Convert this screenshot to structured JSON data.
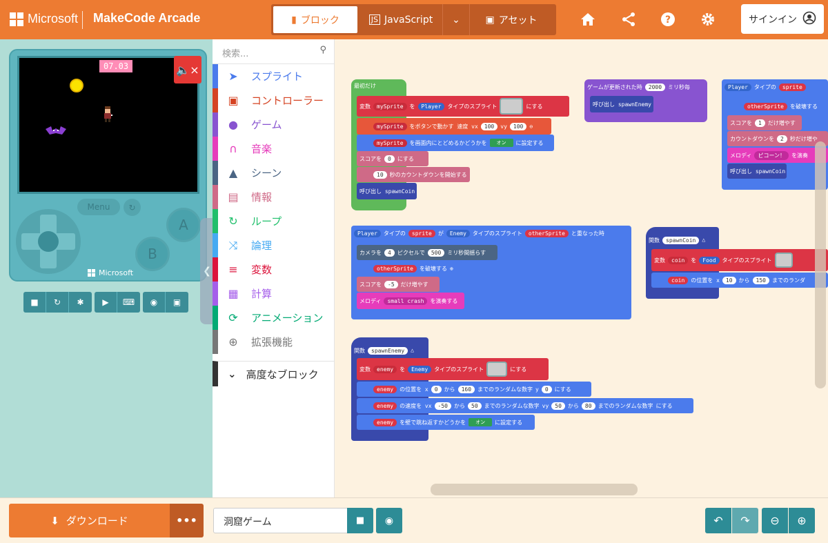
{
  "header": {
    "brand": "Microsoft",
    "product": "MakeCode Arcade",
    "tabs": [
      {
        "label": "ブロック"
      },
      {
        "label": "JavaScript"
      },
      {
        "label": "アセット"
      }
    ],
    "signin": "サインイン"
  },
  "simulator": {
    "timer": "07.03",
    "menu_label": "Menu",
    "btn_a": "A",
    "btn_b": "B",
    "brand": "Microsoft"
  },
  "toolbox": {
    "search_placeholder": "検索...",
    "categories": [
      {
        "label": "スプライト",
        "icon": "paper-plane-icon",
        "color": "#4b7bec"
      },
      {
        "label": "コントローラー",
        "icon": "gamepad-icon",
        "color": "#d54322"
      },
      {
        "label": "ゲーム",
        "icon": "circle-icon",
        "color": "#8854d0"
      },
      {
        "label": "音楽",
        "icon": "headphones-icon",
        "color": "#e63cbb"
      },
      {
        "label": "シーン",
        "icon": "tree-icon",
        "color": "#4b6584"
      },
      {
        "label": "情報",
        "icon": "id-card-icon",
        "color": "#cf6a87"
      },
      {
        "label": "ループ",
        "icon": "loop-icon",
        "color": "#20bf6b"
      },
      {
        "label": "論理",
        "icon": "shuffle-icon",
        "color": "#45aaf2"
      },
      {
        "label": "変数",
        "icon": "list-icon",
        "color": "#dc143c"
      },
      {
        "label": "計算",
        "icon": "calculator-icon",
        "color": "#a55eea"
      },
      {
        "label": "アニメーション",
        "icon": "refresh-icon",
        "color": "#03aa74"
      },
      {
        "label": "拡張機能",
        "icon": "plus-circle-icon",
        "color": "#777777"
      }
    ],
    "advanced": "高度なブロック"
  },
  "blocks": {
    "start": "最初だけ",
    "b1_var": "変数",
    "b1_name": "mySprite",
    "b1_to": "を",
    "b1_kind": "Player",
    "b1_type": "タイプのスプライト",
    "b1_set": "にする",
    "b2_name": "mySprite",
    "b2_text": "をボタンで動かす 速度 vx",
    "b2_vx": "100",
    "b2_vy_label": "vy",
    "b2_vy": "100",
    "b3_name": "mySprite",
    "b3_text": "を画面内にとどめるかどうかを",
    "b3_val": "オン",
    "b3_set": "に設定する",
    "b4_text": "スコアを",
    "b4_val": "0",
    "b4_set": "にする",
    "b5_val": "10",
    "b5_text": "秒のカウントダウンを開始する",
    "b6_text": "呼び出し spawnCoin",
    "u_text": "ゲームが更新された時",
    "u_val": "2000",
    "u_unit": "ミリ秒毎",
    "u_call": "呼び出し spawnEnemy",
    "o_kind": "Player",
    "o_of": "タイプの",
    "o_sprite": "sprite",
    "o_text": "が",
    "o_kind2": "Enemy",
    "o_type2": "タイプのスプライト",
    "o_other": "otherSprite",
    "o_end": "と重なった時",
    "o_cam": "カメラを",
    "o_cam_px": "4",
    "o_cam_text": "ピクセルで",
    "o_cam_ms": "500",
    "o_cam_end": "ミリ秒間揺らす",
    "o_destroy": "otherSprite",
    "o_destroy_text": "を破壊する",
    "o_score": "スコアを",
    "o_score_val": "-5",
    "o_score_end": "だけ増やす",
    "o_melody": "メロディ",
    "o_melody_val": "small crash",
    "o_melody_end": "を演奏する",
    "e_fn": "関数",
    "e_name": "spawnEnemy",
    "e_var": "変数",
    "e_varname": "enemy",
    "e_to": "を",
    "e_kind": "Enemy",
    "e_type": "タイプのスプライト",
    "e_set": "にする",
    "e2_name": "enemy",
    "e2_text": "の位置を x",
    "e2_x1": "0",
    "e2_from": "から",
    "e2_x2": "160",
    "e2_rand": "までのランダムな数字",
    "e2_y": "y",
    "e2_yv": "0",
    "e2_set": "にする",
    "e3_name": "enemy",
    "e3_text": "の速度を vx",
    "e3_v1": "-50",
    "e3_from": "から",
    "e3_v2": "50",
    "e3_rand": "までのランダムな数字",
    "e3_vy": "vy",
    "e3_v3": "50",
    "e3_from2": "から",
    "e3_v4": "80",
    "e3_rand2": "までのランダムな数字",
    "e3_set": "にする",
    "e4_name": "enemy",
    "e4_text": "を壁で跳ね返すかどうかを",
    "e4_val": "オン",
    "e4_set": "に設定する",
    "c_fn": "関数",
    "c_name": "spawnCoin",
    "c_var": "変数",
    "c_varname": "coin",
    "c_to": "を",
    "c_kind": "Food",
    "c_type": "タイプのスプライト",
    "c2_name": "coin",
    "c2_text": "の位置を x",
    "c2_x1": "10",
    "c2_from": "から",
    "c2_x2": "150",
    "c2_rand": "までのランダ",
    "p_kind": "Player",
    "p_of": "タイプの",
    "p_sprite": "sprite",
    "p_other": "otherSprite",
    "p_destroy": "を破壊する",
    "p_score": "スコアを",
    "p_score_val": "1",
    "p_score_end": "だけ増やす",
    "p_count": "カウントダウンを",
    "p_count_val": "2",
    "p_count_end": "秒だけ増や",
    "p_melody": "メロディ",
    "p_melody_val": "ピコーン！",
    "p_melody_end": "を演奏",
    "p_call": "呼び出し spawnCoin"
  },
  "footer": {
    "download": "ダウンロード",
    "more": "•••",
    "project_name": "洞窟ゲーム"
  }
}
